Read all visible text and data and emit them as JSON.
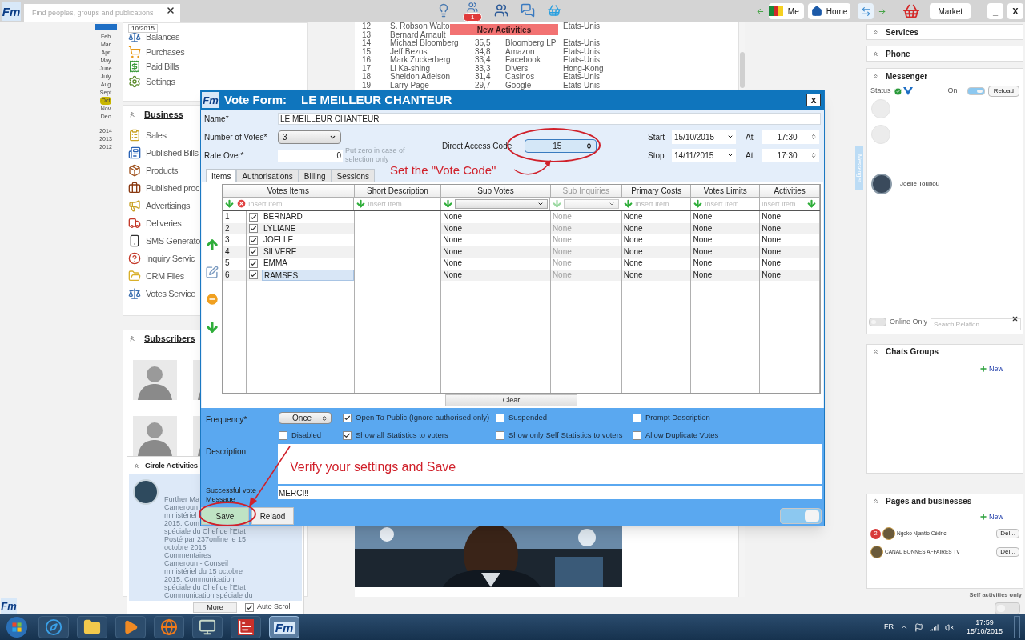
{
  "topbar": {
    "brand": "Fm",
    "search_placeholder": "Find peoples, groups and publications",
    "notification_count": "1",
    "me": "Me",
    "home": "Home",
    "market": "Market",
    "minimize": "_",
    "close": "X"
  },
  "new_activities": "New Activities",
  "calendar": {
    "tooltip": "10/2015",
    "months": [
      {
        "label": "Feb",
        "selected": false
      },
      {
        "label": "Mar",
        "selected": false
      },
      {
        "label": "Apr",
        "selected": false
      },
      {
        "label": "May",
        "selected": false
      },
      {
        "label": "June",
        "selected": false
      },
      {
        "label": "July",
        "selected": false
      },
      {
        "label": "Aug",
        "selected": false
      },
      {
        "label": "Sept",
        "selected": false
      },
      {
        "label": "Oct",
        "selected": true
      },
      {
        "label": "Nov",
        "selected": false
      },
      {
        "label": "Dec",
        "selected": false
      }
    ],
    "years": [
      "2014",
      "2013",
      "2012"
    ]
  },
  "account_menu": [
    {
      "label": "Balances",
      "kind": "balances"
    },
    {
      "label": "Purchases",
      "kind": "purchases"
    },
    {
      "label": "Paid Bills",
      "kind": "paid_bills"
    },
    {
      "label": "Settings",
      "kind": "settings"
    }
  ],
  "business": {
    "title": "Business",
    "items": [
      {
        "label": "Sales",
        "kind": "sales"
      },
      {
        "label": "Published Bills",
        "kind": "published_bills"
      },
      {
        "label": "Products",
        "kind": "products"
      },
      {
        "label": "Published proc",
        "kind": "published_products"
      },
      {
        "label": "Advertisings",
        "kind": "advertisings"
      },
      {
        "label": "Deliveries",
        "kind": "deliveries"
      },
      {
        "label": "SMS Generato",
        "kind": "sms"
      },
      {
        "label": "Inquiry Servic",
        "kind": "inquiry"
      },
      {
        "label": "CRM Files",
        "kind": "crm"
      },
      {
        "label": "Votes Service",
        "kind": "votes"
      }
    ]
  },
  "subscribers": {
    "title": "Subscribers"
  },
  "ranking": [
    {
      "rank": "12",
      "name": "S. Robson Walto",
      "country": "Etats-Unis"
    },
    {
      "rank": "13",
      "name": "Bernard Arnault"
    },
    {
      "rank": "14",
      "name": "Michael Bloomberg",
      "value": "35,5",
      "company": "Bloomberg LP",
      "country": "Etats-Unis"
    },
    {
      "rank": "15",
      "name": "Jeff Bezos",
      "value": "34,8",
      "company": "Amazon",
      "country": "Etats-Unis"
    },
    {
      "rank": "16",
      "name": "Mark Zuckerberg",
      "value": "33,4",
      "company": "Facebook",
      "country": "Etats-Unis"
    },
    {
      "rank": "17",
      "name": "Li Ka-shing",
      "value": "33,3",
      "company": "Divers",
      "country": "Hong-Kong"
    },
    {
      "rank": "18",
      "name": "Sheldon Adelson",
      "value": "31,4",
      "company": "Casinos",
      "country": "Etats-Unis"
    },
    {
      "rank": "19",
      "name": "Larry Page",
      "value": "29,7",
      "company": "Google",
      "country": "Etats-Unis"
    }
  ],
  "circle_activities": {
    "title": "Circle Activities",
    "lines": [
      "Further Ma",
      "Cameroun",
      "ministériel",
      "2015: Com",
      "spéciale du Chef de l'Etat",
      "Posté par 237online le 15",
      "octobre 2015",
      "Commentaires",
      "Cameroun - Conseil",
      "ministériel du 15 octobre",
      "2015: Communication",
      "spéciale du Chef de l'Etat",
      "Communication spéciale du"
    ],
    "more": "More",
    "auto_scroll": {
      "label": "Auto Scroll",
      "checked": true
    }
  },
  "bottom_logo": "Fm",
  "side_tab": "Messenger",
  "right_panel": {
    "services": "Services",
    "phone": "Phone",
    "messenger": {
      "title": "Messenger",
      "status": "Status",
      "on_label": "On",
      "on": true,
      "reload": "Reload",
      "contact": "Joelle Toubou",
      "online_only": {
        "label": "Online Only",
        "on": false
      },
      "search_placeholder": "Search Relation"
    },
    "chats_groups": {
      "title": "Chats Groups",
      "new": "New"
    },
    "pages": {
      "title": "Pages and businesses",
      "new": "New",
      "items": [
        {
          "name": "Ngoko Njantio Cédric",
          "badge": "2",
          "action": "Del..."
        },
        {
          "name": "CANAL BONNES AFFAIRES TV",
          "action": "Del..."
        }
      ]
    },
    "self_activities": {
      "label": "Self activities only",
      "on": false
    }
  },
  "vote_form": {
    "logo": "Fm",
    "title_prefix": "Vote Form:",
    "title": "LE MEILLEUR CHANTEUR",
    "close": "x",
    "name": {
      "label": "Name*",
      "value": "LE MEILLEUR CHANTEUR"
    },
    "number_of_votes": {
      "label": "Number of Votes*",
      "value": "3"
    },
    "rate_over": {
      "label": "Rate Over*",
      "value": "0",
      "hint": "Put zero in case of selection only"
    },
    "direct_access_code": {
      "label": "Direct Access Code",
      "value": "15"
    },
    "start": {
      "label": "Start",
      "date": "15/10/2015",
      "at": "At",
      "time": "17:30"
    },
    "stop": {
      "label": "Stop",
      "date": "14/11/2015",
      "at": "At",
      "time": "17:30"
    },
    "tabs": [
      {
        "label": "Items",
        "selected": true
      },
      {
        "label": "Authorisations",
        "selected": false
      },
      {
        "label": "Billing",
        "selected": false
      },
      {
        "label": "Sessions",
        "selected": false
      }
    ],
    "columns": [
      {
        "title": "Votes Items",
        "kind": "input",
        "placeholder": "Insert Item",
        "clearable": true,
        "arrow_right": false,
        "disabled": false
      },
      {
        "title": "Short Description",
        "kind": "input",
        "placeholder": "Insert Item",
        "clearable": false,
        "arrow_right": false,
        "disabled": false
      },
      {
        "title": "Sub Votes",
        "kind": "select",
        "clearable": false,
        "arrow_right": false,
        "disabled": false
      },
      {
        "title": "Sub Inquiries",
        "kind": "select",
        "clearable": false,
        "arrow_right": false,
        "disabled": true
      },
      {
        "title": "Primary Costs",
        "kind": "input",
        "placeholder": "Insert Item",
        "clearable": false,
        "arrow_right": false,
        "disabled": false
      },
      {
        "title": "Votes Limits",
        "kind": "input",
        "placeholder": "Insert Item",
        "clearable": false,
        "arrow_right": false,
        "disabled": false
      },
      {
        "title": "Activities",
        "kind": "input",
        "placeholder": "Insert Item",
        "clearable": false,
        "arrow_right": true,
        "disabled": false
      }
    ],
    "rows": [
      {
        "number": "1",
        "checked": true,
        "name": "BERNARD",
        "selected": false,
        "cells": [
          "None",
          "None",
          "None",
          "None",
          "None"
        ]
      },
      {
        "number": "2",
        "checked": true,
        "name": "LYLIANE",
        "selected": false,
        "cells": [
          "None",
          "None",
          "None",
          "None",
          "None"
        ]
      },
      {
        "number": "3",
        "checked": true,
        "name": "JOELLE",
        "selected": false,
        "cells": [
          "None",
          "None",
          "None",
          "None",
          "None"
        ]
      },
      {
        "number": "4",
        "checked": true,
        "name": "SILVERE",
        "selected": false,
        "cells": [
          "None",
          "None",
          "None",
          "None",
          "None"
        ]
      },
      {
        "number": "5",
        "checked": true,
        "name": "EMMA",
        "selected": false,
        "cells": [
          "None",
          "None",
          "None",
          "None",
          "None"
        ]
      },
      {
        "number": "6",
        "checked": true,
        "name": "RAMSES",
        "selected": true,
        "cells": [
          "None",
          "None",
          "None",
          "None",
          "None"
        ]
      }
    ],
    "clear": "Clear",
    "frequency": {
      "label": "Frequency*",
      "value": "Once"
    },
    "options": [
      {
        "label": "Open To Public (Ignore authorised only)",
        "checked": true
      },
      {
        "label": "Suspended",
        "checked": false
      },
      {
        "label": "Prompt Description",
        "checked": false
      },
      {
        "label": "Disabled",
        "checked": false
      },
      {
        "label": "Show all Statistics to voters",
        "checked": true
      },
      {
        "label": "Show only Self Statistics to voters",
        "checked": false
      },
      {
        "label": "Allow Duplicate Votes",
        "checked": false
      }
    ],
    "description": {
      "label": "Description"
    },
    "message": {
      "label": "Successful vote Message",
      "value": "MERCI!!"
    },
    "buttons": [
      {
        "label": "Save",
        "kind": "primary"
      },
      {
        "label": "Relaod",
        "kind": "secondary"
      }
    ],
    "toggle": {
      "on": true
    }
  },
  "annotations": [
    {
      "text": "Set the \"Vote Code\""
    },
    {
      "text": "Verify your settings and Save"
    }
  ],
  "taskbar": {
    "apps": [
      {
        "kind": "start",
        "active": false
      },
      {
        "kind": "browser",
        "active": false
      },
      {
        "kind": "files",
        "active": false
      },
      {
        "kind": "media",
        "active": false
      },
      {
        "kind": "firefox",
        "active": false
      },
      {
        "kind": "computer",
        "active": false
      },
      {
        "kind": "chart",
        "active": false
      },
      {
        "kind": "fm",
        "label": "Fm",
        "active": true
      }
    ],
    "language": "FR",
    "time": "17:59",
    "date": "15/10/2015"
  }
}
